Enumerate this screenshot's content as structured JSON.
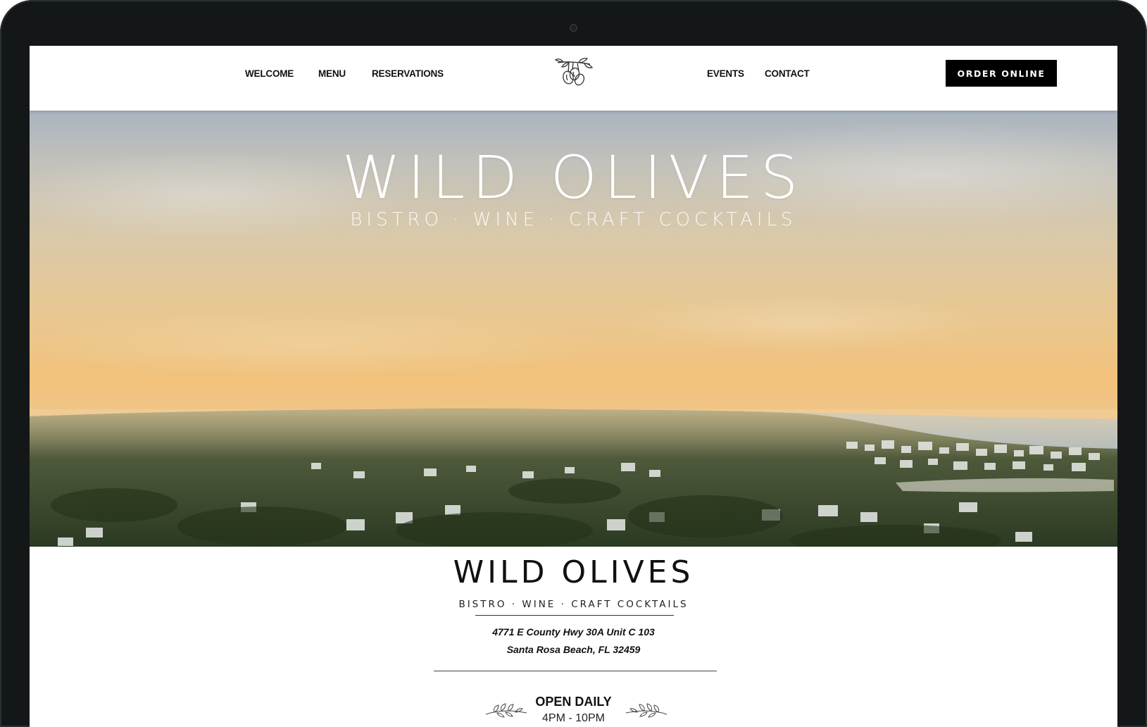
{
  "nav": {
    "left": [
      {
        "label": "WELCOME"
      },
      {
        "label": "MENU"
      },
      {
        "label": "RESERVATIONS"
      }
    ],
    "right": [
      {
        "label": "EVENTS"
      },
      {
        "label": "CONTACT"
      }
    ],
    "logo_icon": "olive-branch-icon",
    "order_button": "ORDER ONLINE"
  },
  "hero": {
    "title": "WILD OLIVES",
    "subtitle": "BISTRO · WINE · CRAFT COCKTAILS"
  },
  "info": {
    "title": "WILD OLIVES",
    "subtitle": "BISTRO · WINE · CRAFT COCKTAILS",
    "address_line1": "4771 E County Hwy 30A Unit C 103",
    "address_line2": "Santa Rosa Beach, FL 32459",
    "open_label": "OPEN DAILY",
    "hours": "4PM - 10PM",
    "sprig_icon": "laurel-sprig-icon"
  },
  "colors": {
    "device_frame": "#141718",
    "button_bg": "#000000",
    "text": "#111111"
  }
}
